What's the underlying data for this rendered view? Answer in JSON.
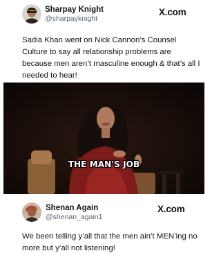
{
  "tweets": [
    {
      "author": {
        "name": "Sharpay Knight",
        "handle": "@sharpayknight"
      },
      "brand": "X.com",
      "text": "Sadia Khan went on Nick Cannon’s Counsel Culture to say all relationship problems are because men aren’t masculine enough & that’s all I needed to hear!",
      "media": {
        "caption": "THE MAN'S JOB"
      }
    },
    {
      "author": {
        "name": "Shenan Again",
        "handle": "@shenan_again1"
      },
      "brand": "X.com",
      "text": "We been telling y’all that the men ain’t MEN’ing no more but y’all not listening!"
    }
  ]
}
